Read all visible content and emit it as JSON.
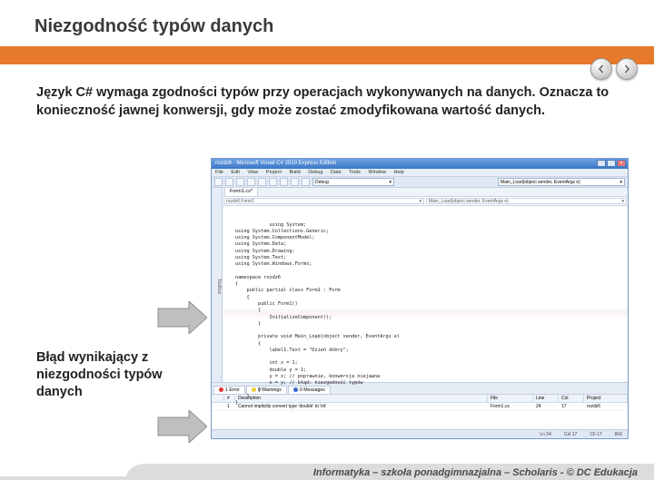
{
  "title": "Niezgodność typów danych",
  "nav": {
    "prev": "prev",
    "next": "next"
  },
  "body_text": "Język C# wymaga zgodności typów przy operacjach wykonywanych na danych. Oznacza to konieczność jawnej konwersji, gdy może zostać zmodyfikowana wartość danych.",
  "callout1": "Błąd wynikający z niezgodności typów danych",
  "footer": "Informatyka – szkoła ponadgimnazjalna – Scholaris - © DC Edukacja",
  "ide": {
    "window_title": "rozdz6 - Microsoft Visual C# 2010 Express Edition",
    "menu": [
      "File",
      "Edit",
      "View",
      "Project",
      "Build",
      "Debug",
      "Data",
      "Tools",
      "Window",
      "Help"
    ],
    "toolbar_dropdown": "Debug",
    "left_panel": "Toolbox",
    "tab": "Form1.cs*",
    "nav_left": "rozdz6.Form1",
    "nav_right": "Main_Load(object sender, EventArgs e)",
    "code": "using System;\nusing System.Collections.Generic;\nusing System.ComponentModel;\nusing System.Data;\nusing System.Drawing;\nusing System.Text;\nusing System.Windows.Forms;\n\nnamespace rozdz6\n{\n    public partial class Form1 : Form\n    {\n        public Form1()\n        {\n            InitializeComponent();\n        }\n\n        private void Main_Load(object sender, EventArgs e)\n        {\n            label1.Text = \"Dzień dobry\";\n\n            int x = 1;\n            double y = 1;\n            y = x; // poprawnie, konwersja niejawna\n            x = y; // błąd: niezgodność typów\n        }\n    }\n}",
    "errorlist": {
      "tabs": {
        "errors": "1 Error",
        "warnings": "0 Warnings",
        "messages": "0 Messages"
      },
      "columns": [
        "",
        "#",
        "Description",
        "File",
        "Line",
        "Col",
        "Project"
      ],
      "row": {
        "num": "1",
        "desc": "Cannot implicitly convert type 'double' to 'int'",
        "file": "Form1.cs",
        "line": "24",
        "col": "17",
        "project": "rozdz6"
      }
    },
    "status": {
      "ln": "Ln 24",
      "col": "Col 17",
      "ch": "Ch 17",
      "ins": "INS"
    }
  }
}
